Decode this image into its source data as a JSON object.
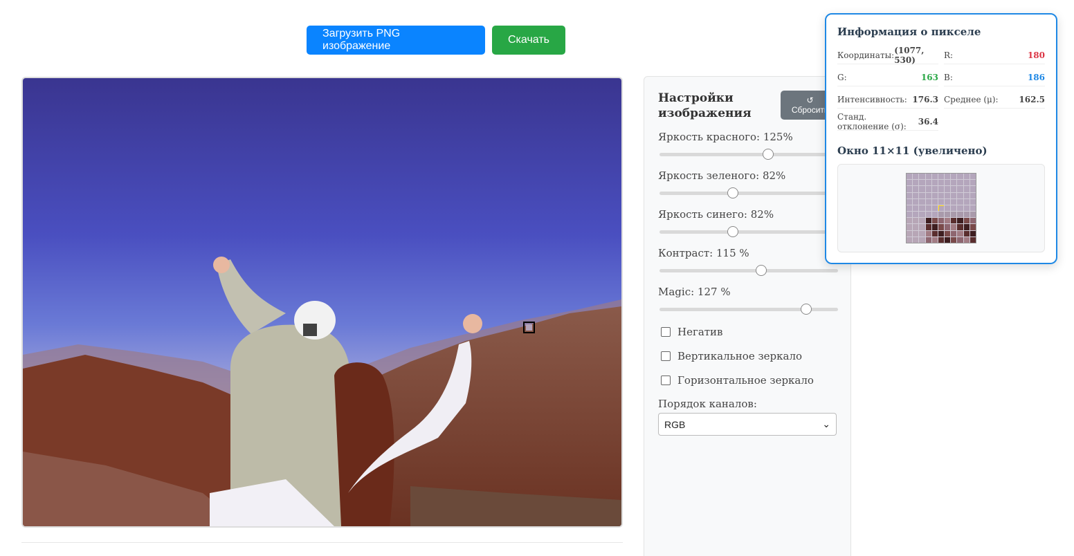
{
  "toolbar": {
    "upload_label": "Загрузить PNG изображение",
    "download_label": "Скачать"
  },
  "settings": {
    "title": "Настройки изображения",
    "reset_icon": "↺",
    "reset_label": "Сбросить",
    "sliders": [
      {
        "label": "Яркость красного: 125%",
        "fraction": 0.61
      },
      {
        "label": "Яркость зеленого: 82%",
        "fraction": 0.41
      },
      {
        "label": "Яркость синего: 82%",
        "fraction": 0.41
      },
      {
        "label": "Контраст: 115 %",
        "fraction": 0.57
      },
      {
        "label": "Magic: 127 %",
        "fraction": 0.82
      }
    ],
    "checkboxes": [
      {
        "label": "Негатив",
        "checked": false
      },
      {
        "label": "Вертикальное зеркало",
        "checked": false
      },
      {
        "label": "Горизонтальное зеркало",
        "checked": false
      }
    ],
    "channel_order_label": "Порядок каналов:",
    "channel_order_value": "RGB"
  },
  "pixel_info": {
    "title": "Информация о пикселе",
    "coords_label": "Координаты:",
    "coords_value": "(1077, 530)",
    "r_label": "R:",
    "r_value": "180",
    "g_label": "G:",
    "g_value": "163",
    "b_label": "B:",
    "b_value": "186",
    "intensity_label": "Интенсивность:",
    "intensity_value": "176.3",
    "mean_label": "Среднее (μ):",
    "mean_value": "162.5",
    "std_label": "Станд. отклонение (σ):",
    "std_value": "36.4",
    "window_title": "Окно 11×11 (увеличено)",
    "colors": {
      "r": "#dc3545",
      "g": "#28a745",
      "b": "#1e88e5"
    }
  }
}
